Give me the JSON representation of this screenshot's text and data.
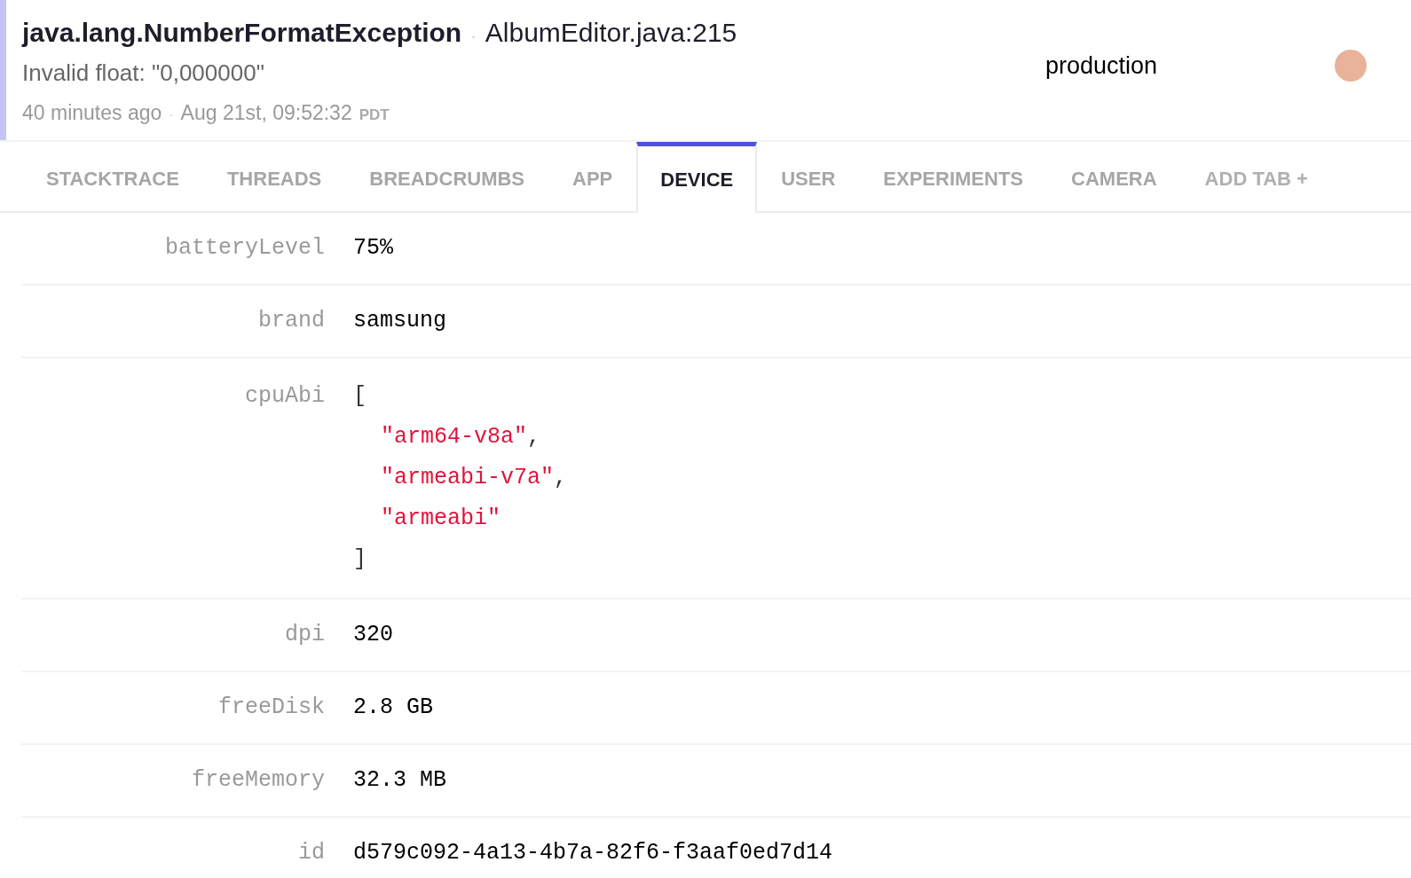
{
  "header": {
    "exception": "java.lang.NumberFormatException",
    "separator": "·",
    "location": "AlbumEditor.java:215",
    "message": "Invalid float: \"0,000000\"",
    "relative_time": "40 minutes ago",
    "time_separator": "·",
    "timestamp": "Aug 21st, 09:52:32",
    "timezone": "PDT",
    "stage": "production"
  },
  "tabs": [
    {
      "label": "STACKTRACE",
      "selected": false,
      "kind": "tab"
    },
    {
      "label": "THREADS",
      "selected": false,
      "kind": "tab"
    },
    {
      "label": "BREADCRUMBS",
      "selected": false,
      "kind": "tab"
    },
    {
      "label": "APP",
      "selected": false,
      "kind": "tab"
    },
    {
      "label": "DEVICE",
      "selected": true,
      "kind": "tab"
    },
    {
      "label": "USER",
      "selected": false,
      "kind": "tab"
    },
    {
      "label": "EXPERIMENTS",
      "selected": false,
      "kind": "tab"
    },
    {
      "label": "CAMERA",
      "selected": false,
      "kind": "tab"
    },
    {
      "label": "ADD TAB +",
      "selected": false,
      "kind": "add"
    }
  ],
  "rows": [
    {
      "kind": "text",
      "key": "batteryLevel",
      "value": "75%"
    },
    {
      "kind": "text",
      "key": "brand",
      "value": "samsung"
    },
    {
      "kind": "array",
      "key": "cpuAbi",
      "open": "[",
      "close": "]",
      "items": [
        {
          "text": "\"arm64-v8a\"",
          "separator": ","
        },
        {
          "text": "\"armeabi-v7a\"",
          "separator": ","
        },
        {
          "text": "\"armeabi\""
        }
      ]
    },
    {
      "kind": "text",
      "key": "dpi",
      "value": "320"
    },
    {
      "kind": "text",
      "key": "freeDisk",
      "value": "2.8 GB"
    },
    {
      "kind": "text",
      "key": "freeMemory",
      "value": "32.3 MB"
    },
    {
      "kind": "text",
      "key": "id",
      "value": "d579c092-4a13-4b7a-82f6-f3aaf0ed7d14"
    }
  ]
}
